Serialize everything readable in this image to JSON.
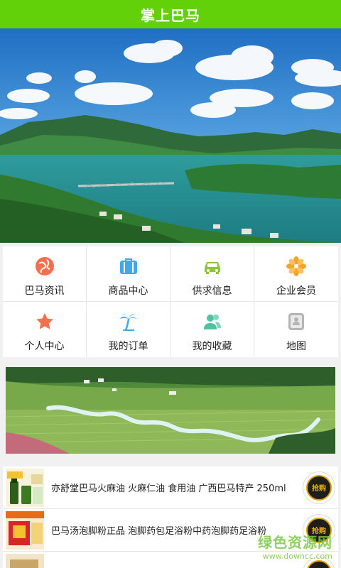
{
  "header": {
    "title": "掌上巴马"
  },
  "colors": {
    "header_green": "#62d10a",
    "badge_gold": "#f3b400"
  },
  "menu": [
    {
      "label": "巴马资讯",
      "icon": "globe-icon",
      "color": "#f2704e"
    },
    {
      "label": "商品中心",
      "icon": "shopping-bag-icon",
      "color": "#41a9e6"
    },
    {
      "label": "供求信息",
      "icon": "car-icon",
      "color": "#8cc63f"
    },
    {
      "label": "企业会员",
      "icon": "flower-icon",
      "color": "#f5a623"
    },
    {
      "label": "个人中心",
      "icon": "star-icon",
      "color": "#f2704e"
    },
    {
      "label": "我的订单",
      "icon": "palm-tree-icon",
      "color": "#41a9e6"
    },
    {
      "label": "我的收藏",
      "icon": "users-icon",
      "color": "#4fc3a1"
    },
    {
      "label": "地图",
      "icon": "contact-card-icon",
      "color": "#a0a0a0"
    }
  ],
  "products": [
    {
      "name": "亦舒堂巴马火麻油 火麻仁油 食用油 广西巴马特产 250ml",
      "buy_label": "抢购"
    },
    {
      "name": "巴马汤泡脚粉正品 泡脚药包足浴粉中药泡脚药足浴粉",
      "buy_label": "抢购"
    },
    {
      "name": "",
      "buy_label": "抢购"
    }
  ],
  "watermark": {
    "line1": "绿色资源网",
    "line2": "www.downcc.com"
  }
}
